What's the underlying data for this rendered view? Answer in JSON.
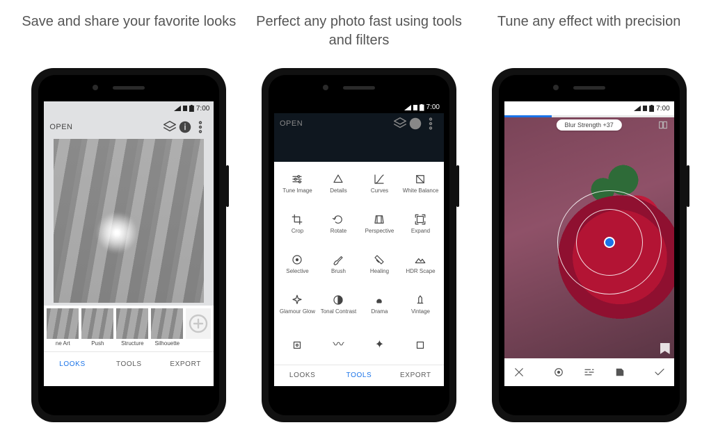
{
  "status_time": "7:00",
  "columns": [
    {
      "headline": "Save and share your favorite looks"
    },
    {
      "headline": "Perfect any photo fast using tools and filters"
    },
    {
      "headline": "Tune any effect with precision"
    }
  ],
  "phone1": {
    "open_label": "OPEN",
    "looks": [
      {
        "label": "ne Art"
      },
      {
        "label": "Push"
      },
      {
        "label": "Structure"
      },
      {
        "label": "Silhouette"
      }
    ],
    "tabs": {
      "looks": "LOOKS",
      "tools": "TOOLS",
      "export": "EXPORT"
    }
  },
  "phone2": {
    "open_label": "OPEN",
    "tools": [
      {
        "id": "tune-image",
        "label": "Tune Image"
      },
      {
        "id": "details",
        "label": "Details"
      },
      {
        "id": "curves",
        "label": "Curves"
      },
      {
        "id": "white-balance",
        "label": "White Balance"
      },
      {
        "id": "crop",
        "label": "Crop"
      },
      {
        "id": "rotate",
        "label": "Rotate"
      },
      {
        "id": "perspective",
        "label": "Perspective"
      },
      {
        "id": "expand",
        "label": "Expand"
      },
      {
        "id": "selective",
        "label": "Selective"
      },
      {
        "id": "brush",
        "label": "Brush"
      },
      {
        "id": "healing",
        "label": "Healing"
      },
      {
        "id": "hdr-scape",
        "label": "HDR Scape"
      },
      {
        "id": "glamour-glow",
        "label": "Glamour Glow"
      },
      {
        "id": "tonal-contrast",
        "label": "Tonal Contrast"
      },
      {
        "id": "drama",
        "label": "Drama"
      },
      {
        "id": "vintage",
        "label": "Vintage"
      }
    ],
    "tabs": {
      "looks": "LOOKS",
      "tools": "TOOLS",
      "export": "EXPORT"
    }
  },
  "phone3": {
    "pill": "Blur Strength +37"
  }
}
